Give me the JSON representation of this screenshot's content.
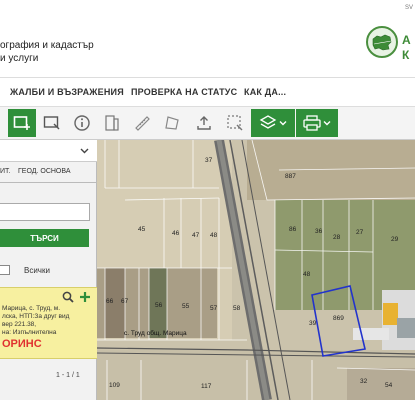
{
  "header": {
    "lang": "SV",
    "org_line1": "ография и кадастър",
    "org_line2": "и услуги",
    "logo_text1": "А",
    "logo_text2": "К"
  },
  "nav": [
    "ЖАЛБИ И ВЪЗРАЖЕНИЯ",
    "ПРОВЕРКА НА СТАТУС",
    "КАК ДА..."
  ],
  "toolbar": {
    "icons": [
      "select-rect-icon",
      "select-window-icon",
      "info-icon",
      "tabs-icon",
      "ruler-icon",
      "area-icon",
      "export-icon",
      "clear-selection-icon",
      "layers-icon",
      "print-icon"
    ],
    "accent": "#2f8f3a"
  },
  "sidebar": {
    "tabs": [
      "ИТ.",
      "ГЕОД. ОСНОВА"
    ],
    "search_value": "",
    "search_label": "ТЪРСИ",
    "select_all_label": "Всички",
    "result": {
      "lines": [
        "Марица, с. Труд, м.",
        "лска, НТП:За друг вид",
        "вер 221.38,",
        "на: Изпълнителна"
      ],
      "tag": "ОРИНС"
    },
    "pager": "1 - 1 / 1"
  },
  "map": {
    "plots": [
      "37",
      "887",
      "45",
      "46",
      "47",
      "48",
      "86",
      "28",
      "27",
      "36",
      "29",
      "48",
      "66",
      "67",
      "55",
      "57",
      "58",
      "56",
      "39",
      "869",
      "109",
      "117",
      "32",
      "54"
    ],
    "road_label": "с. Труд общ. Марица",
    "highlight_color": "#2233cc"
  }
}
